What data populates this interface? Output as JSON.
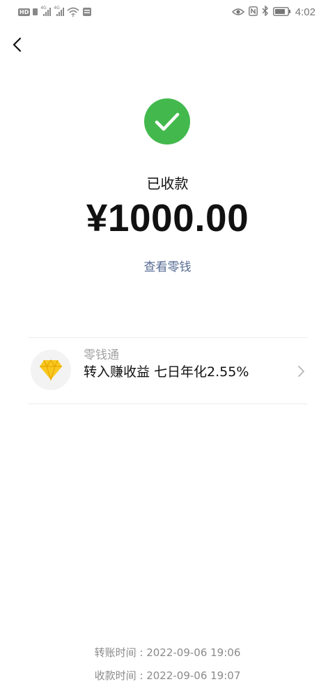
{
  "status_bar": {
    "hd_label": "HD",
    "network_1": "4G",
    "network_2": "4G",
    "time": "4:02"
  },
  "header": {
    "back_icon": "chevron-left-icon"
  },
  "result": {
    "status_icon": "check-circle-icon",
    "status_label": "已收款",
    "amount": "¥1000.00",
    "view_change_link": "查看零钱"
  },
  "promo": {
    "icon": "diamond-icon",
    "name": "零钱通",
    "description": "转入赚收益 七日年化2.55%",
    "chevron_icon": "chevron-right-icon"
  },
  "times": {
    "transfer": "转账时间 : 2022-09-06 19:06",
    "receive": "收款时间 : 2022-09-06 19:07"
  },
  "colors": {
    "success_green": "#43b94d",
    "link_blue": "#576b95",
    "diamond_yellow": "#f8c81f"
  }
}
